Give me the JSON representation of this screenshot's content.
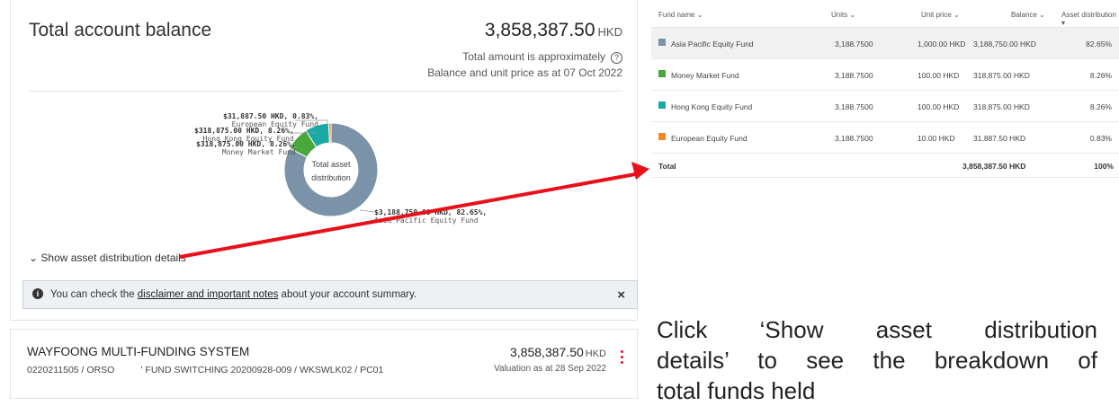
{
  "summary": {
    "title": "Total account balance",
    "total_amount": "3,858,387.50",
    "currency": "HKD",
    "approx_note": "Total amount is approximately",
    "as_at": "Balance and unit price as at 07 Oct 2022"
  },
  "donut": {
    "center_line1": "Total asset",
    "center_line2": "distribution",
    "labels": [
      {
        "amount": "$31,887.50 HKD, 0.83%,",
        "name": "European Equity Fund"
      },
      {
        "amount": "$318,875.00 HKD, 8.26%,",
        "name": "Hong Kong Equity Fund"
      },
      {
        "amount": "$318,875.00 HKD, 8.26%,",
        "name": "Money Market Fund"
      },
      {
        "amount": "$3,188,750.00 HKD, 82.65%,",
        "name": "Asia Pacific Equity Fund"
      }
    ]
  },
  "chart_data": {
    "type": "pie",
    "categories": [
      "Asia Pacific Equity Fund",
      "Money Market Fund",
      "Hong Kong Equity Fund",
      "European Equity Fund"
    ],
    "values": [
      82.65,
      8.26,
      8.26,
      0.83
    ],
    "colors": [
      "#7b93a8",
      "#4aa83a",
      "#1aa9a5",
      "#f08a24"
    ]
  },
  "details_toggle": "Show asset distribution details",
  "notice": {
    "prefix": "You can check the",
    "link": "disclaimer and important notes",
    "suffix": "about your account summary.",
    "close": "×"
  },
  "system": {
    "name": "WAYFOONG MULTI-FUNDING SYSTEM",
    "account": "0220211505 / ORSO",
    "scheme": "' FUND SWITCHING 20200928-009 / WKSWLK02 / PC01",
    "balance": "3,858,387.50",
    "currency": "HKD",
    "valuation": "Valuation as at 28 Sep 2022"
  },
  "table": {
    "headers": [
      "Fund name",
      "Units",
      "Unit price",
      "Balance",
      "Asset distribution"
    ],
    "rows": [
      {
        "fund": "Asia Pacific Equity Fund",
        "units": "3,188.7500",
        "price": "1,000.00 HKD",
        "balance": "3,188,750.00 HKD",
        "dist": "82.65%",
        "color": "#7b93a8"
      },
      {
        "fund": "Money Market Fund",
        "units": "3,188.7500",
        "price": "100.00 HKD",
        "balance": "318,875.00 HKD",
        "dist": "8.26%",
        "color": "#4aa83a"
      },
      {
        "fund": "Hong Kong Equity Fund",
        "units": "3,188.7500",
        "price": "100.00 HKD",
        "balance": "318,875.00 HKD",
        "dist": "8.26%",
        "color": "#1aa9a5"
      },
      {
        "fund": "European Equity Fund",
        "units": "3,188.7500",
        "price": "10.00 HKD",
        "balance": "31,887.50 HKD",
        "dist": "0.83%",
        "color": "#f08a24"
      }
    ],
    "total_label": "Total",
    "total_balance": "3,858,387.50 HKD",
    "total_dist": "100%"
  },
  "caption": {
    "line1": "Click ‘Show asset distribution",
    "line2": "details’ to see the breakdown of",
    "line3": "total funds held"
  },
  "arrow_color": "#e8101a"
}
